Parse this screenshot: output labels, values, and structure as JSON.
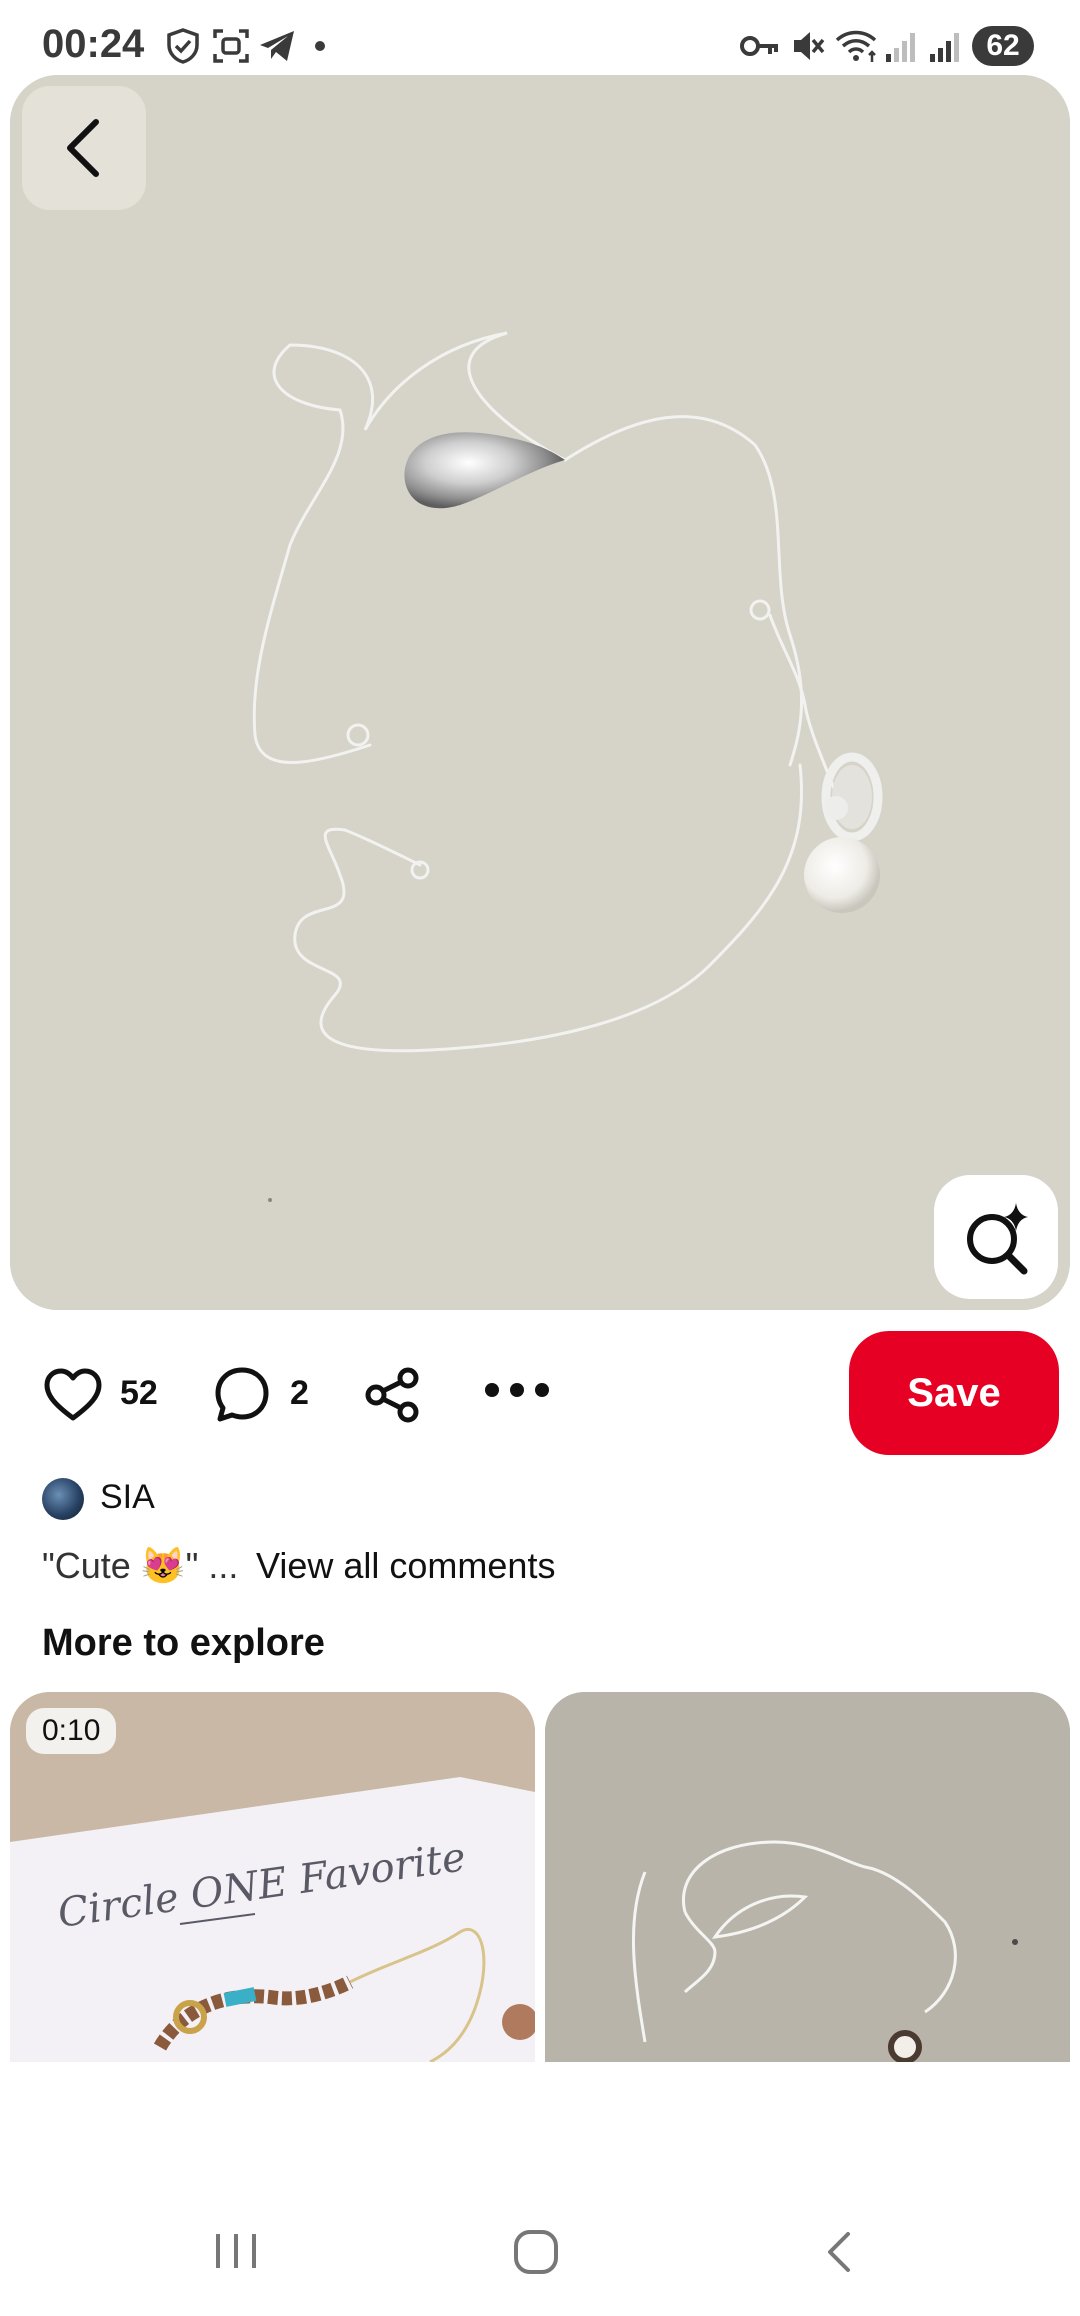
{
  "status_bar": {
    "time": "00:24",
    "battery": "62"
  },
  "pin": {
    "likes": "52",
    "comments": "2",
    "save_label": "Save"
  },
  "creator": {
    "name": "SIA"
  },
  "comment_preview": "\"Cute 😻\" ...",
  "view_comments_label": "View all comments",
  "more_to_explore": "More to explore",
  "thumbnails": {
    "first_duration": "0:10",
    "first_caption": "Circle ONE Favorite"
  },
  "icons": [
    "back-icon",
    "visual-search-icon",
    "heart-icon",
    "comment-icon",
    "share-icon",
    "more-icon",
    "recents-icon",
    "home-icon",
    "nav-back-icon"
  ],
  "colors": {
    "accent": "#e60023",
    "photo_bg": "#d6d3c9"
  }
}
